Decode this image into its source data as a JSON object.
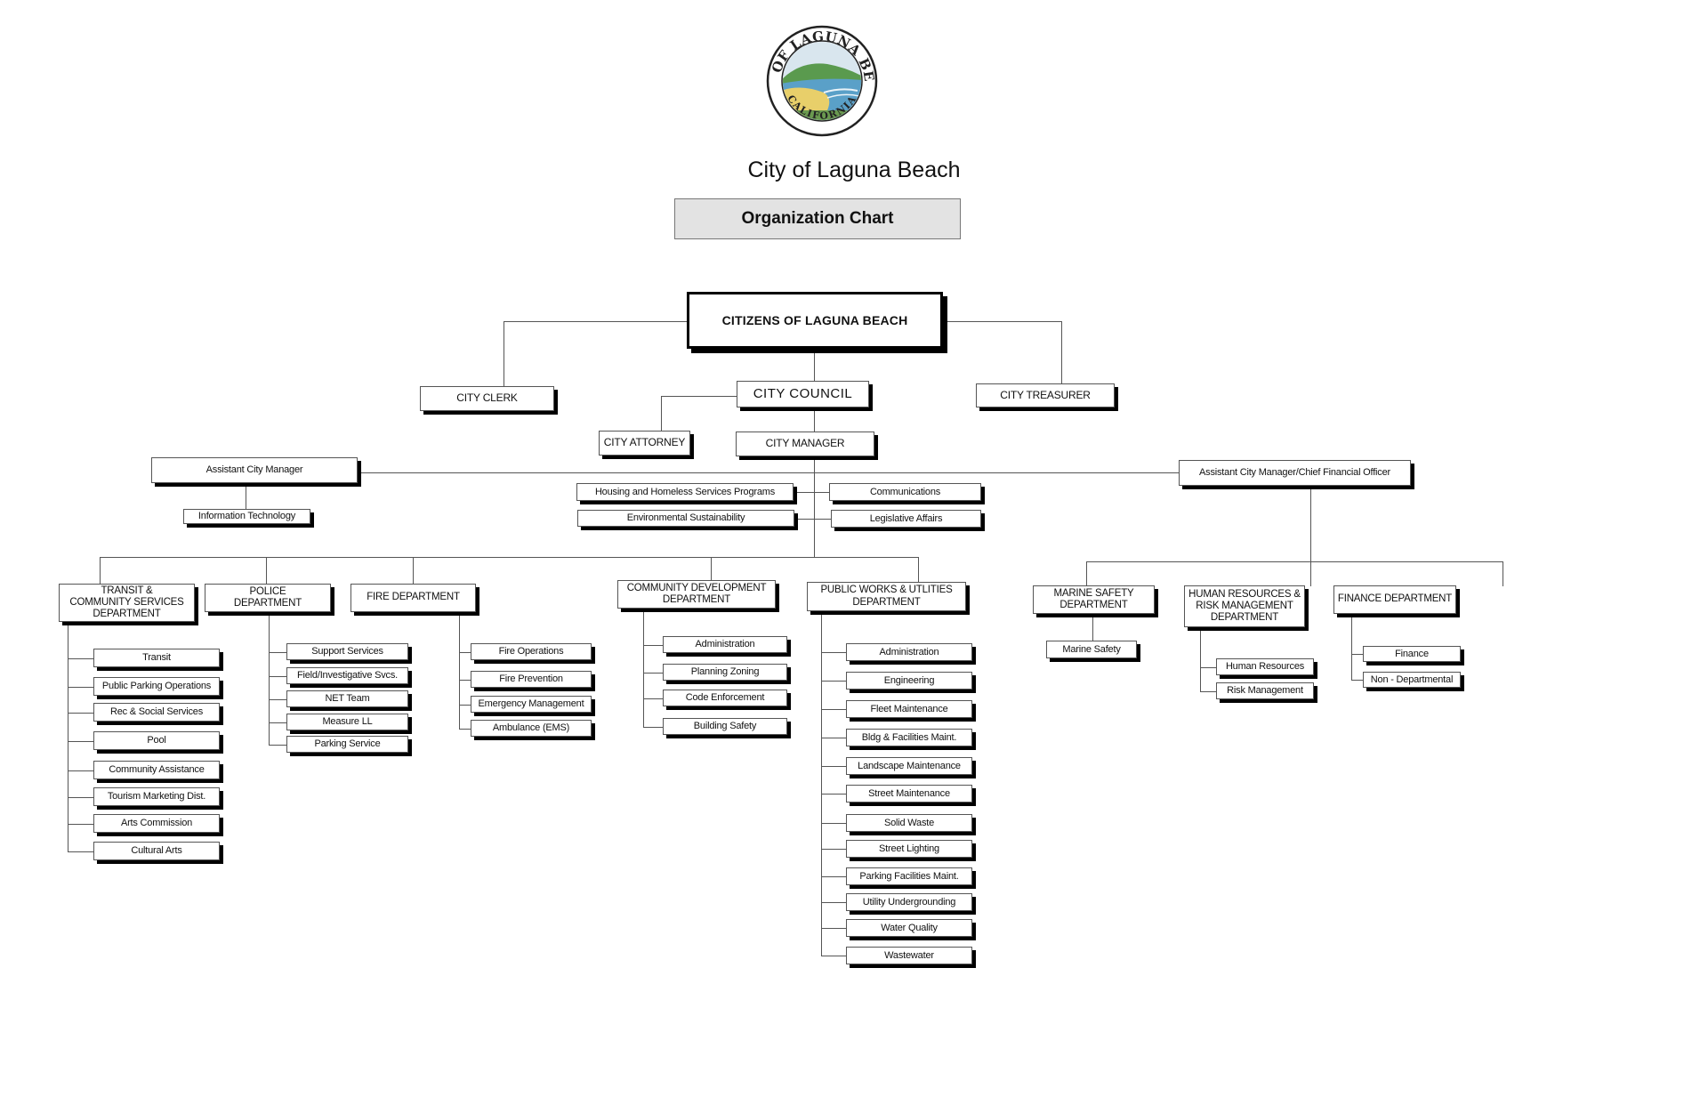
{
  "header": {
    "logo": {
      "icon": "city-seal-icon",
      "top_text": "CITY OF LAGUNA BEACH",
      "bottom_text": "CALIFORNIA"
    },
    "title": "City of Laguna Beach",
    "subtitle": "Organization Chart"
  },
  "chart": {
    "root": "CITIZENS OF LAGUNA BEACH",
    "city_clerk": "CITY CLERK",
    "city_council": "CITY  COUNCIL",
    "city_treasurer": "CITY TREASURER",
    "city_attorney": "CITY ATTORNEY",
    "city_manager": "CITY MANAGER",
    "assistant_city_manager": {
      "label": "Assistant City Manager",
      "children": [
        "Information Technology"
      ]
    },
    "manager_offices": {
      "left": [
        "Housing and Homeless Services Programs",
        "Environmental Sustainability"
      ],
      "right": [
        "Communications",
        "Legislative Affairs"
      ]
    },
    "acm_cfo": {
      "label": "Assistant City Manager/Chief Financial Officer"
    },
    "departments": [
      {
        "label": "TRANSIT &\nCOMMUNITY SERVICES\nDEPARTMENT",
        "children": [
          "Transit",
          "Public Parking Operations",
          "Rec & Social Services",
          "Pool",
          "Community Assistance",
          "Tourism Marketing Dist.",
          "Arts Commission",
          "Cultural Arts"
        ]
      },
      {
        "label": "POLICE\nDEPARTMENT",
        "children": [
          "Support Services",
          "Field/Investigative Svcs.",
          "NET Team",
          "Measure LL",
          "Parking Service"
        ]
      },
      {
        "label": "FIRE DEPARTMENT",
        "children": [
          "Fire Operations",
          "Fire Prevention",
          "Emergency Management",
          "Ambulance (EMS)"
        ]
      },
      {
        "label": "COMMUNITY DEVELOPMENT\nDEPARTMENT",
        "children": [
          "Administration",
          "Planning  Zoning",
          "Code Enforcement",
          "Building Safety"
        ]
      },
      {
        "label": "PUBLIC WORKS & UTLITIES\nDEPARTMENT",
        "children": [
          "Administration",
          "Engineering",
          "Fleet Maintenance",
          "Bldg & Facilities Maint.",
          "Landscape Maintenance",
          "Street Maintenance",
          "Solid Waste",
          "Street Lighting",
          "Parking Facilities Maint.",
          "Utility Undergrounding",
          "Water Quality",
          "Wastewater"
        ]
      },
      {
        "label": "MARINE SAFETY\nDEPARTMENT",
        "children": [
          "Marine Safety"
        ]
      },
      {
        "label": "HUMAN RESOURCES &\nRISK MANAGEMENT\nDEPARTMENT",
        "children": [
          "Human Resources",
          "Risk Management"
        ]
      },
      {
        "label": "FINANCE DEPARTMENT",
        "children": [
          "Finance",
          "Non - Departmental"
        ]
      }
    ]
  },
  "colors": {
    "subtitle_bg": "#e3e3e3",
    "line": "#555555",
    "shadow": "#000000"
  }
}
